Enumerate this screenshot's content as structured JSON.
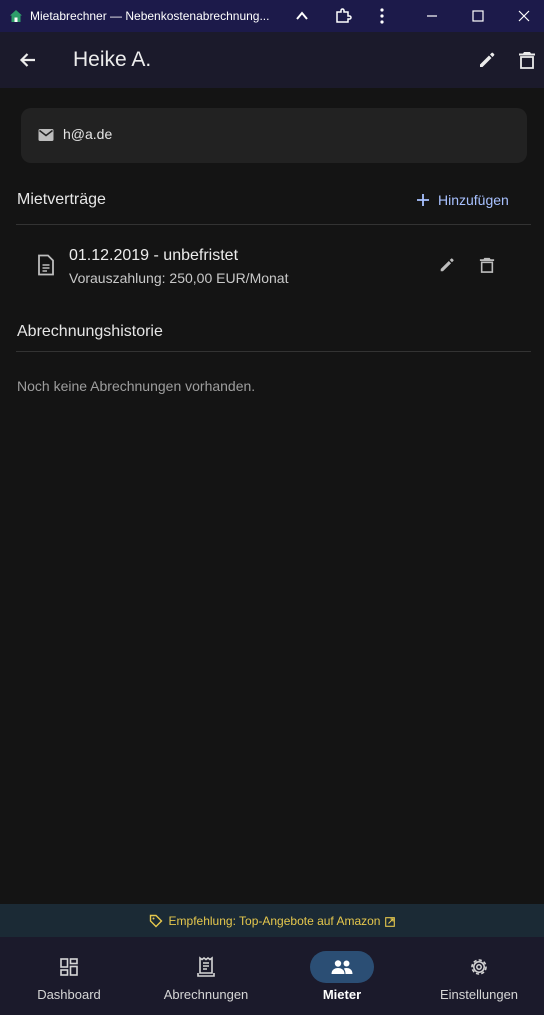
{
  "window": {
    "title": "Mietabrechner — Nebenkostenabrechnung..."
  },
  "appbar": {
    "name": "Heike A."
  },
  "contact": {
    "email": "h@a.de"
  },
  "contracts": {
    "title": "Mietverträge",
    "add_label": "Hinzufügen",
    "items": [
      {
        "period": "01.12.2019 - unbefristet",
        "payment": "Vorauszahlung: 250,00 EUR/Monat"
      }
    ]
  },
  "history": {
    "title": "Abrechnungshistorie",
    "empty_text": "Noch keine Abrechnungen vorhanden."
  },
  "recommendation": {
    "text": "Empfehlung: Top-Angebote auf Amazon"
  },
  "nav": {
    "items": [
      {
        "label": "Dashboard",
        "icon": "dashboard-icon",
        "active": false
      },
      {
        "label": "Abrechnungen",
        "icon": "receipt-icon",
        "active": false
      },
      {
        "label": "Mieter",
        "icon": "people-icon",
        "active": true
      },
      {
        "label": "Einstellungen",
        "icon": "gear-icon",
        "active": false
      }
    ]
  },
  "colors": {
    "titlebar": "#1c1a4a",
    "appbar": "#1b1a2b",
    "background": "#141414",
    "accent": "#a8c1ff",
    "active_pill": "#2b4e74",
    "recommendation_text": "#e6c84d"
  }
}
